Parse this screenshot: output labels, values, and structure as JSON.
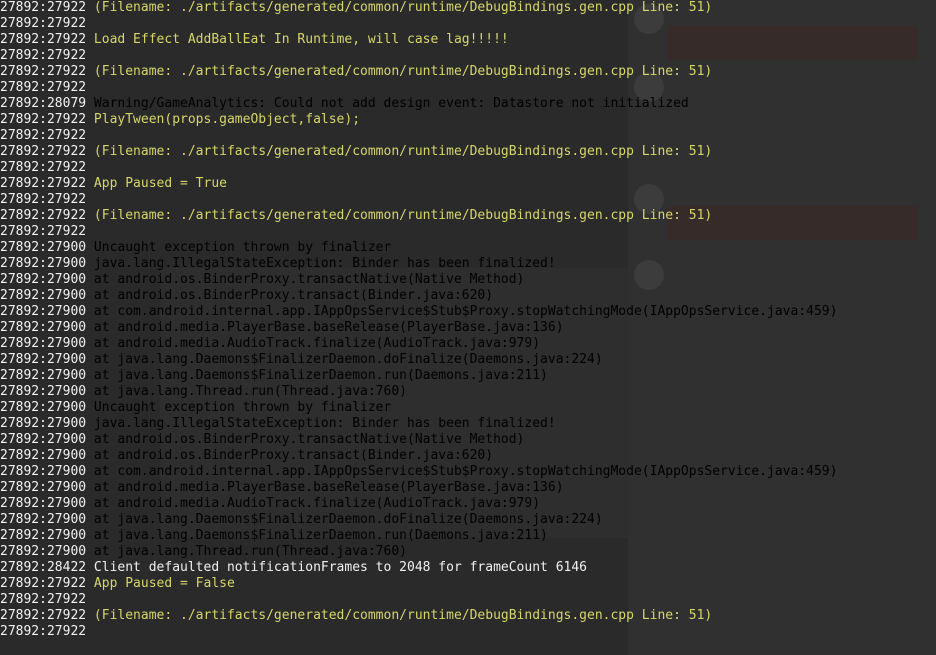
{
  "window": {
    "title": ""
  },
  "colors": {
    "timestamp": "#f2f2f2",
    "debug": "#d6d66a",
    "warning": "#e6e6c0",
    "error": "#e0315a",
    "info": "#f0f0f0",
    "background": "#262626"
  },
  "log": {
    "lines": [
      {
        "ts": "27892:27922",
        "level": "debug",
        "text": "(Filename: ./artifacts/generated/common/runtime/DebugBindings.gen.cpp Line: 51)"
      },
      {
        "ts": "27892:27922",
        "level": "debug",
        "text": ""
      },
      {
        "ts": "27892:27922",
        "level": "debug",
        "text": "Load Effect AddBallEat In Runtime, will case lag!!!!!"
      },
      {
        "ts": "27892:27922",
        "level": "debug",
        "text": ""
      },
      {
        "ts": "27892:27922",
        "level": "debug",
        "text": "(Filename: ./artifacts/generated/common/runtime/DebugBindings.gen.cpp Line: 51)"
      },
      {
        "ts": "27892:27922",
        "level": "debug",
        "text": ""
      },
      {
        "ts": "27892:28079",
        "level": "warning",
        "text": "Warning/GameAnalytics: Could not add design event: Datastore not initialized"
      },
      {
        "ts": "27892:27922",
        "level": "debug",
        "text": "PlayTween(props.gameObject,false);"
      },
      {
        "ts": "27892:27922",
        "level": "debug",
        "text": ""
      },
      {
        "ts": "27892:27922",
        "level": "debug",
        "text": "(Filename: ./artifacts/generated/common/runtime/DebugBindings.gen.cpp Line: 51)"
      },
      {
        "ts": "27892:27922",
        "level": "debug",
        "text": ""
      },
      {
        "ts": "27892:27922",
        "level": "debug",
        "text": "App Paused = True"
      },
      {
        "ts": "27892:27922",
        "level": "debug",
        "text": ""
      },
      {
        "ts": "27892:27922",
        "level": "debug",
        "text": "(Filename: ./artifacts/generated/common/runtime/DebugBindings.gen.cpp Line: 51)"
      },
      {
        "ts": "27892:27922",
        "level": "debug",
        "text": ""
      },
      {
        "ts": "27892:27900",
        "level": "error",
        "text": "Uncaught exception thrown by finalizer"
      },
      {
        "ts": "27892:27900",
        "level": "error",
        "text": "java.lang.IllegalStateException: Binder has been finalized!"
      },
      {
        "ts": "27892:27900",
        "level": "error",
        "text": "at android.os.BinderProxy.transactNative(Native Method)"
      },
      {
        "ts": "27892:27900",
        "level": "error",
        "text": "at android.os.BinderProxy.transact(Binder.java:620)"
      },
      {
        "ts": "27892:27900",
        "level": "error",
        "text": "at com.android.internal.app.IAppOpsService$Stub$Proxy.stopWatchingMode(IAppOpsService.java:459)"
      },
      {
        "ts": "27892:27900",
        "level": "error",
        "text": "at android.media.PlayerBase.baseRelease(PlayerBase.java:136)"
      },
      {
        "ts": "27892:27900",
        "level": "error",
        "text": "at android.media.AudioTrack.finalize(AudioTrack.java:979)"
      },
      {
        "ts": "27892:27900",
        "level": "error",
        "text": "at java.lang.Daemons$FinalizerDaemon.doFinalize(Daemons.java:224)"
      },
      {
        "ts": "27892:27900",
        "level": "error",
        "text": "at java.lang.Daemons$FinalizerDaemon.run(Daemons.java:211)"
      },
      {
        "ts": "27892:27900",
        "level": "error",
        "text": "at java.lang.Thread.run(Thread.java:760)"
      },
      {
        "ts": "27892:27900",
        "level": "error",
        "text": "Uncaught exception thrown by finalizer"
      },
      {
        "ts": "27892:27900",
        "level": "error",
        "text": "java.lang.IllegalStateException: Binder has been finalized!"
      },
      {
        "ts": "27892:27900",
        "level": "error",
        "text": "at android.os.BinderProxy.transactNative(Native Method)"
      },
      {
        "ts": "27892:27900",
        "level": "error",
        "text": "at android.os.BinderProxy.transact(Binder.java:620)"
      },
      {
        "ts": "27892:27900",
        "level": "error",
        "text": "at com.android.internal.app.IAppOpsService$Stub$Proxy.stopWatchingMode(IAppOpsService.java:459)"
      },
      {
        "ts": "27892:27900",
        "level": "error",
        "text": "at android.media.PlayerBase.baseRelease(PlayerBase.java:136)"
      },
      {
        "ts": "27892:27900",
        "level": "error",
        "text": "at android.media.AudioTrack.finalize(AudioTrack.java:979)"
      },
      {
        "ts": "27892:27900",
        "level": "error",
        "text": "at java.lang.Daemons$FinalizerDaemon.doFinalize(Daemons.java:224)"
      },
      {
        "ts": "27892:27900",
        "level": "error",
        "text": "at java.lang.Daemons$FinalizerDaemon.run(Daemons.java:211)"
      },
      {
        "ts": "27892:27900",
        "level": "error",
        "text": "at java.lang.Thread.run(Thread.java:760)"
      },
      {
        "ts": "27892:28422",
        "level": "info",
        "text": "Client defaulted notificationFrames to 2048 for frameCount 6146"
      },
      {
        "ts": "27892:27922",
        "level": "debug",
        "text": "App Paused = False"
      },
      {
        "ts": "27892:27922",
        "level": "debug",
        "text": ""
      },
      {
        "ts": "27892:27922",
        "level": "debug",
        "text": "(Filename: ./artifacts/generated/common/runtime/DebugBindings.gen.cpp Line: 51)"
      },
      {
        "ts": "27892:27922",
        "level": "debug",
        "text": ""
      }
    ]
  }
}
